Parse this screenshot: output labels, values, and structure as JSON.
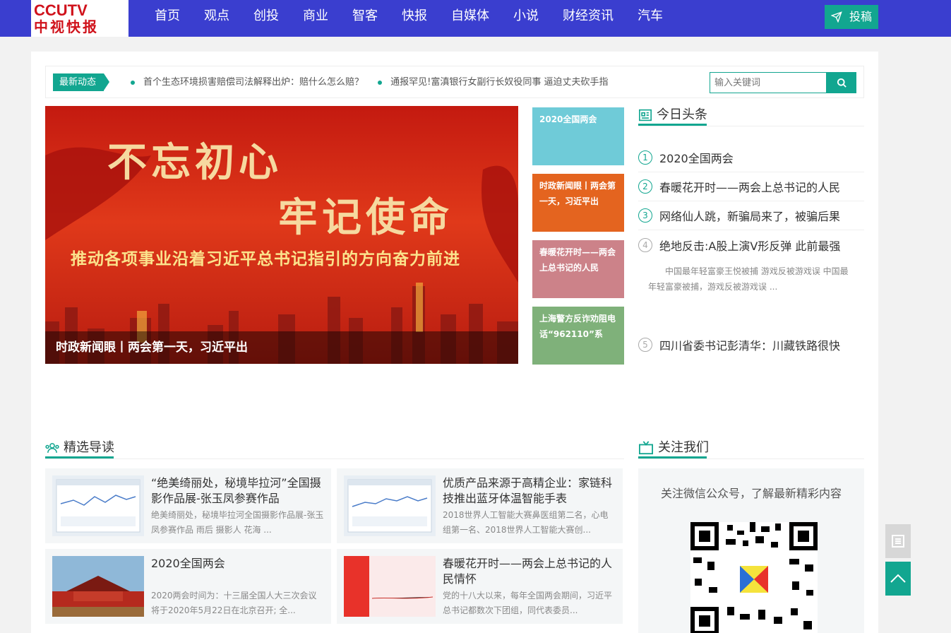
{
  "header": {
    "logo_top": "CCUTV",
    "logo_bottom": "中视快报",
    "nav": [
      "首页",
      "观点",
      "创投",
      "商业",
      "智客",
      "快报",
      "自媒体",
      "小说",
      "财经资讯",
      "汽车"
    ],
    "submit_label": "投稿"
  },
  "ticker": {
    "tag": "最新动态",
    "items": [
      "首个生态环境损害赔偿司法解释出炉：赔什么怎么赔？",
      "通报罕见!富滇银行女副行长奴役同事 逼迫丈夫砍手指"
    ]
  },
  "search": {
    "placeholder": "输入关键词"
  },
  "slider": {
    "line1": "不忘初心",
    "line2": "牢记使命",
    "line3": "推动各项事业沿着习近平总书记指引的方向奋力前进",
    "caption": "时政新闻眼丨两会第一天，习近平出"
  },
  "tiles": [
    {
      "label": "2020全国两会",
      "color": "#6fcbd8"
    },
    {
      "label": "时政新闻眼丨两会第一天，习近平出",
      "color": "#e4641f"
    },
    {
      "label": "春暖花开时——两会上总书记的人民",
      "color": "#cc8289"
    },
    {
      "label": "上海警方反诈劝阻电话“962110”系",
      "color": "#7fb17a"
    }
  ],
  "headlines": {
    "title": "今日头条",
    "items": [
      {
        "num": "1",
        "text": "2020全国两会"
      },
      {
        "num": "2",
        "text": "春暖花开时——两会上总书记的人民"
      },
      {
        "num": "3",
        "text": "网络仙人跳，新骗局来了，被骗后果"
      },
      {
        "num": "4",
        "text": "绝地反击:A股上演V形反弹 此前最强"
      },
      {
        "num": "5",
        "text": "四川省委书记彭清华：川藏铁路很快"
      }
    ],
    "desc": "中国最年轻富豪王悦被捕 游戏反被游戏误 中国最年轻富豪被捕，游戏反被游戏误 ..."
  },
  "featured": {
    "title": "精选导读",
    "cards": [
      {
        "title": "“绝美绮丽处，秘境毕拉河”全国摄影作品展-张玉凤参赛作品",
        "desc": "绝美绮丽处，秘境毕拉河全国摄影作品展-张玉凤参赛作品 雨后 摄影人 花海 ..."
      },
      {
        "title": "优质产品来源于高精企业：家链科技推出蓝牙体温智能手表",
        "desc": "2018世界人工智能大赛鼻医组第二名，心电组第一名、2018世界人工智能大赛创..."
      },
      {
        "title": "2020全国两会",
        "desc": "2020两会时间为：十三届全国人大三次会议将于2020年5月22日在北京召开; 全..."
      },
      {
        "title": "春暖花开时——两会上总书记的人民情怀",
        "desc": "党的十八大以来，每年全国两会期间，习近平总书记都数次下团组，同代表委员..."
      }
    ]
  },
  "follow": {
    "title": "关注我们",
    "text": "关注微信公众号，了解最新精彩内容"
  },
  "colors": {
    "nav_bg": "#3a3ecf",
    "accent": "#12a690"
  }
}
